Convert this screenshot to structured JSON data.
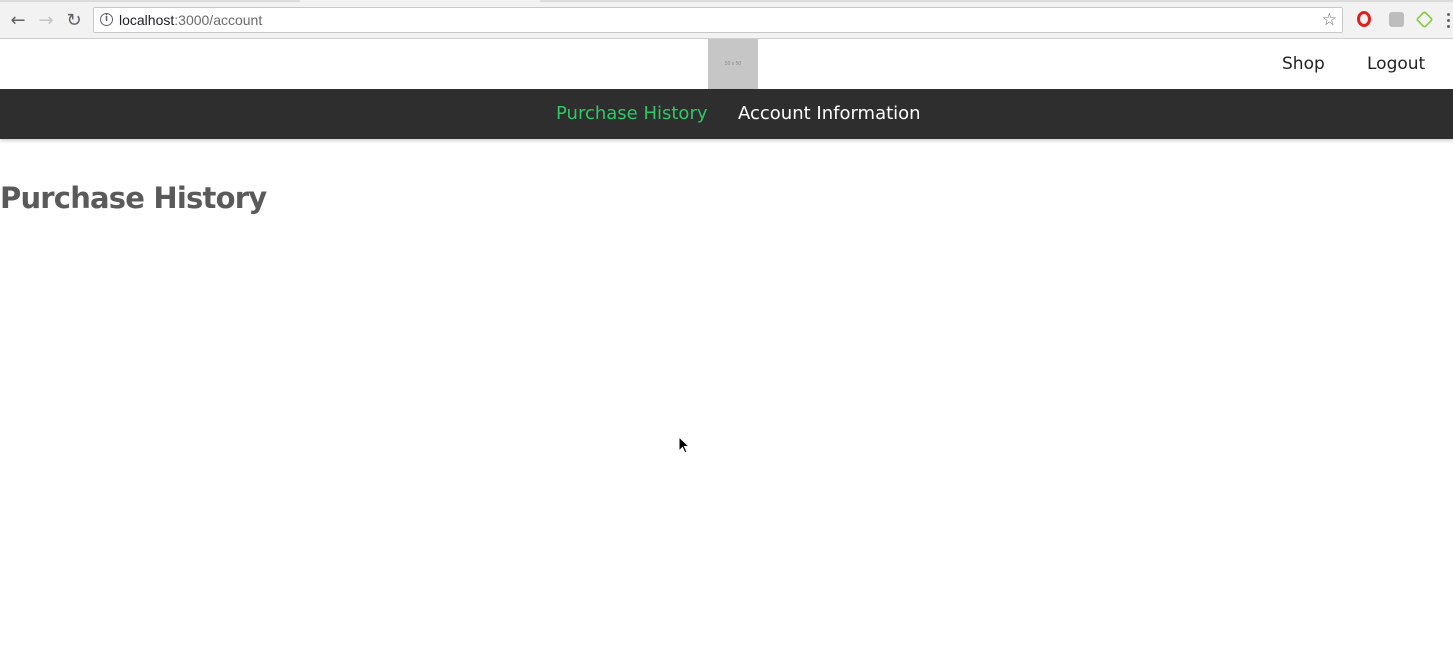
{
  "browser": {
    "url_host": "localhost",
    "url_rest": ":3000/account",
    "back_icon": "←",
    "forward_icon": "→",
    "reload_icon": "↻",
    "info_icon": "i",
    "star_icon": "☆"
  },
  "header": {
    "logo_text": "50 x 50",
    "links": {
      "shop": "Shop",
      "logout": "Logout"
    }
  },
  "account_nav": {
    "items": [
      {
        "label": "Purchase History",
        "active": true
      },
      {
        "label": "Account Information",
        "active": false
      }
    ],
    "active_color": "#2ec866",
    "background": "#2e2e2e"
  },
  "main": {
    "title": "Purchase History"
  }
}
